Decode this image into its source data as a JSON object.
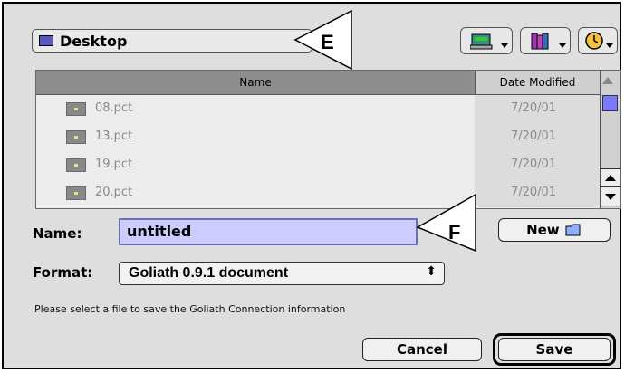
{
  "location_popup": {
    "label": "Desktop",
    "icon": "desktop-folder-icon"
  },
  "toolbar": {
    "buttons": [
      {
        "icon": "shortcuts-drive-icon"
      },
      {
        "icon": "favorites-books-icon"
      },
      {
        "icon": "recent-clock-icon"
      }
    ]
  },
  "file_list": {
    "columns": {
      "name": "Name",
      "date": "Date Modified"
    },
    "rows": [
      {
        "name": "08.pct",
        "date": "7/20/01"
      },
      {
        "name": "13.pct",
        "date": "7/20/01"
      },
      {
        "name": "19.pct",
        "date": "7/20/01"
      },
      {
        "name": "20.pct",
        "date": "7/20/01"
      }
    ]
  },
  "form": {
    "name_label": "Name:",
    "name_value": "untitled",
    "new_button": "New",
    "format_label": "Format:",
    "format_value": "Goliath 0.9.1 document",
    "format_arrows": "⬍",
    "hint": "Please select a file to save the Goliath Connection information"
  },
  "buttons": {
    "cancel": "Cancel",
    "save": "Save"
  },
  "callouts": {
    "e": "E",
    "f": "F"
  },
  "colors": {
    "selection": "#ccccff",
    "callout_text": "#d40000",
    "scroll_thumb": "#7a7aff"
  }
}
